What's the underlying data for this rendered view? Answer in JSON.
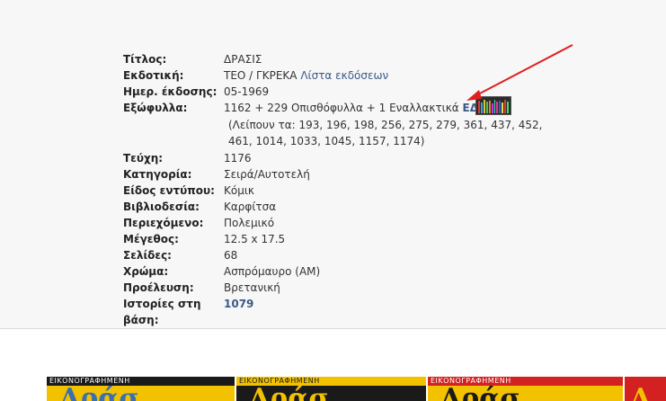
{
  "details": {
    "rows": [
      {
        "label": "Τίτλος:",
        "value": "ΔΡΑΣΙΣ"
      },
      {
        "label": "Εκδοτική:",
        "value": "ΤΕΟ / ΓΚΡΕΚΑ",
        "link": "Λίστα εκδόσεων"
      },
      {
        "label": "Ημερ. έκδοσης:",
        "value": "05-1969"
      },
      {
        "label": "Εξώφυλλα:",
        "value": "1162 + 229 Οπισθόφυλλα + 1 Εναλλακτικά",
        "link": "ΕΔΩ"
      },
      {
        "label": "Τεύχη:",
        "value": "1176"
      },
      {
        "label": "Κατηγορία:",
        "value": "Σειρά/Αυτοτελή"
      },
      {
        "label": "Είδος εντύπου:",
        "value": "Κόμικ"
      },
      {
        "label": "Βιβλιοδεσία:",
        "value": "Καρφίτσα"
      },
      {
        "label": "Περιεχόμενο:",
        "value": "Πολεμικό"
      },
      {
        "label": "Μέγεθος:",
        "value": "12.5 x 17.5"
      },
      {
        "label": "Σελίδες:",
        "value": "68"
      },
      {
        "label": "Χρώμα:",
        "value": "Ασπρόμαυρο (ΑΜ)"
      },
      {
        "label": "Προέλευση:",
        "value": "Βρετανική"
      },
      {
        "label": "Ιστορίες στη",
        "label2": "βάση:",
        "link": "1079"
      }
    ],
    "missing_line1": "(Λείπουν τα: 193, 196, 198, 256, 275, 279, 361, 437, 452,",
    "missing_line2": "461, 1014, 1033, 1045, 1157, 1174)"
  },
  "covers": [
    {
      "header": "ΕΙΚΟΝΟΓΡΑΦΗΜΕΝΗ",
      "bg": "#f2c200",
      "hdr_bg": "#1a1a1a",
      "hdr_color": "#ffffff",
      "text_color": "#3b6fb0"
    },
    {
      "header": "ΕΙΚΟΝΟΓΡΑΦΗΜΕΝΗ",
      "bg": "#1a1a1a",
      "hdr_bg": "#f2c200",
      "hdr_color": "#1a1a1a",
      "text_color": "#f2c200"
    },
    {
      "header": "ΕΙΚΟΝΟΓΡΑΦΗΜΕΝΗ",
      "bg": "#f2c200",
      "hdr_bg": "#d32020",
      "hdr_color": "#ffffff",
      "text_color": "#1a1a1a"
    },
    {
      "header": "",
      "bg": "#d32020",
      "hdr_bg": "#d32020",
      "hdr_color": "#ffffff",
      "text_color": "#f2c200"
    }
  ],
  "colors": {
    "link": "#3b5a86",
    "arrow": "#e01e1e"
  }
}
